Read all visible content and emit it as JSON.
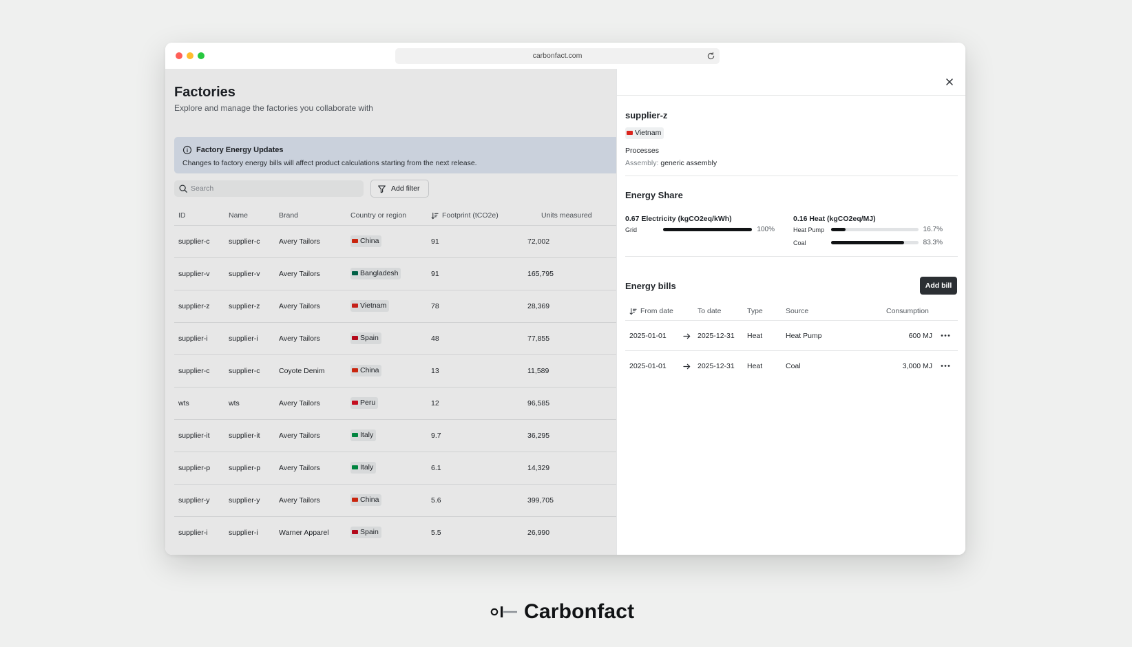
{
  "browser": {
    "url": "carbonfact.com"
  },
  "page": {
    "title": "Factories",
    "subtitle": "Explore and manage the factories you collaborate with"
  },
  "banner": {
    "title": "Factory Energy Updates",
    "text": "Changes to factory energy bills will affect product calculations starting from the next release."
  },
  "search": {
    "placeholder": "Search"
  },
  "filter": {
    "label": "Add filter"
  },
  "table": {
    "columns": [
      "ID",
      "Name",
      "Brand",
      "Country or region",
      "Footprint (tCO2e)",
      "Units measured"
    ],
    "rows": [
      {
        "id": "supplier-c",
        "name": "supplier-c",
        "brand": "Avery Tailors",
        "country": "China",
        "flag": "cn",
        "footprint": "91",
        "units": "72,002"
      },
      {
        "id": "supplier-v",
        "name": "supplier-v",
        "brand": "Avery Tailors",
        "country": "Bangladesh",
        "flag": "bd",
        "footprint": "91",
        "units": "165,795"
      },
      {
        "id": "supplier-z",
        "name": "supplier-z",
        "brand": "Avery Tailors",
        "country": "Vietnam",
        "flag": "vn",
        "footprint": "78",
        "units": "28,369"
      },
      {
        "id": "supplier-i",
        "name": "supplier-i",
        "brand": "Avery Tailors",
        "country": "Spain",
        "flag": "es",
        "footprint": "48",
        "units": "77,855"
      },
      {
        "id": "supplier-c",
        "name": "supplier-c",
        "brand": "Coyote Denim",
        "country": "China",
        "flag": "cn",
        "footprint": "13",
        "units": "11,589"
      },
      {
        "id": "wts",
        "name": "wts",
        "brand": "Avery Tailors",
        "country": "Peru",
        "flag": "pe",
        "footprint": "12",
        "units": "96,585"
      },
      {
        "id": "supplier-it",
        "name": "supplier-it",
        "brand": "Avery Tailors",
        "country": "Italy",
        "flag": "it",
        "footprint": "9.7",
        "units": "36,295"
      },
      {
        "id": "supplier-p",
        "name": "supplier-p",
        "brand": "Avery Tailors",
        "country": "Italy",
        "flag": "it",
        "footprint": "6.1",
        "units": "14,329"
      },
      {
        "id": "supplier-y",
        "name": "supplier-y",
        "brand": "Avery Tailors",
        "country": "China",
        "flag": "cn",
        "footprint": "5.6",
        "units": "399,705"
      },
      {
        "id": "supplier-i",
        "name": "supplier-i",
        "brand": "Warner Apparel",
        "country": "Spain",
        "flag": "es",
        "footprint": "5.5",
        "units": "26,990"
      }
    ]
  },
  "panel": {
    "supplier": "supplier-z",
    "country": "Vietnam",
    "processes_label": "Processes",
    "process_key": "Assembly:",
    "process_value": "generic assembly",
    "energy_share_title": "Energy Share",
    "electricity": {
      "heading": "0.67 Electricity (kgCO2eq/kWh)",
      "items": [
        {
          "label": "Grid",
          "share": 100,
          "pct_label": "100%"
        }
      ]
    },
    "heat": {
      "heading": "0.16 Heat (kgCO2eq/MJ)",
      "items": [
        {
          "label": "Heat Pump",
          "share": 16.7,
          "pct_label": "16.7%"
        },
        {
          "label": "Coal",
          "share": 83.3,
          "pct_label": "83.3%"
        }
      ]
    },
    "bills_title": "Energy bills",
    "add_bill_label": "Add bill",
    "bills_columns": [
      "From date",
      "To date",
      "Type",
      "Source",
      "Consumption"
    ],
    "bills": [
      {
        "from": "2025-01-01",
        "to": "2025-12-31",
        "type": "Heat",
        "source": "Heat Pump",
        "consumption": "600 MJ"
      },
      {
        "from": "2025-01-01",
        "to": "2025-12-31",
        "type": "Heat",
        "source": "Coal",
        "consumption": "3,000 MJ"
      }
    ]
  },
  "brand": {
    "name": "Carbonfact"
  },
  "colors": {
    "background": "#eff0ef",
    "banner": "#dfe7f3",
    "primary_button": "#2b2f33",
    "bar_fill": "#111315",
    "bar_track": "#e1e3e5"
  },
  "icons": [
    "reload-icon",
    "info-icon",
    "search-icon",
    "filter-icon",
    "sort-icon",
    "close-icon",
    "arrow-right-icon",
    "more-icon"
  ]
}
